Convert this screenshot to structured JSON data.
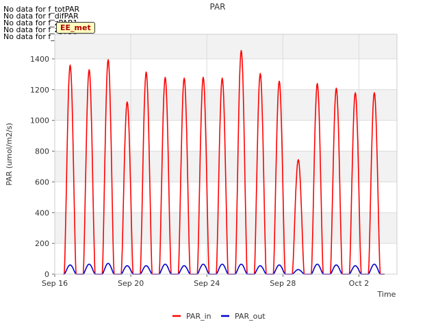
{
  "nodata": [
    "No data for f_totPAR",
    "No data for f_difPAR",
    "No data for f_zPAR1",
    "No data for f_zPAR2",
    "No data for f_zPAR3"
  ],
  "badge": "EE_met",
  "chart_data": {
    "type": "line",
    "title": "PAR",
    "xlabel": "Time",
    "ylabel": "PAR (umol/m2/s)",
    "ylim": [
      0,
      1560
    ],
    "yticks": [
      0,
      200,
      400,
      600,
      800,
      1000,
      1200,
      1400
    ],
    "xlim_days": [
      0,
      18
    ],
    "xticks": [
      {
        "day": 0,
        "label": "Sep 16"
      },
      {
        "day": 4,
        "label": "Sep 20"
      },
      {
        "day": 8,
        "label": "Sep 24"
      },
      {
        "day": 12,
        "label": "Sep 28"
      },
      {
        "day": 16,
        "label": "Oct 2"
      }
    ],
    "grid": true,
    "legend_position": "bottom",
    "series": [
      {
        "name": "PAR_in",
        "color": "#ff0000",
        "daily_peaks": [
          {
            "day": "Sep 16",
            "peak": 1360
          },
          {
            "day": "Sep 17",
            "peak": 1330
          },
          {
            "day": "Sep 18",
            "peak": 1395
          },
          {
            "day": "Sep 19",
            "peak": 1120
          },
          {
            "day": "Sep 20",
            "peak": 1315
          },
          {
            "day": "Sep 21",
            "peak": 1280
          },
          {
            "day": "Sep 22",
            "peak": 1275
          },
          {
            "day": "Sep 23",
            "peak": 1280
          },
          {
            "day": "Sep 24",
            "peak": 1275
          },
          {
            "day": "Sep 25",
            "peak": 1455
          },
          {
            "day": "Sep 26",
            "peak": 1305
          },
          {
            "day": "Sep 27",
            "peak": 1255
          },
          {
            "day": "Sep 28",
            "peak": 745
          },
          {
            "day": "Sep 29",
            "peak": 1240
          },
          {
            "day": "Sep 30",
            "peak": 1210
          },
          {
            "day": "Oct 1",
            "peak": 1180
          },
          {
            "day": "Oct 2",
            "peak": 1180
          }
        ]
      },
      {
        "name": "PAR_out",
        "color": "#0000cc",
        "daily_peaks": [
          {
            "day": "Sep 16",
            "peak": 60
          },
          {
            "day": "Sep 17",
            "peak": 65
          },
          {
            "day": "Sep 18",
            "peak": 70
          },
          {
            "day": "Sep 19",
            "peak": 55
          },
          {
            "day": "Sep 20",
            "peak": 55
          },
          {
            "day": "Sep 21",
            "peak": 65
          },
          {
            "day": "Sep 22",
            "peak": 55
          },
          {
            "day": "Sep 23",
            "peak": 65
          },
          {
            "day": "Sep 24",
            "peak": 65
          },
          {
            "day": "Sep 25",
            "peak": 65
          },
          {
            "day": "Sep 26",
            "peak": 55
          },
          {
            "day": "Sep 27",
            "peak": 60
          },
          {
            "day": "Sep 28",
            "peak": 30
          },
          {
            "day": "Sep 29",
            "peak": 65
          },
          {
            "day": "Sep 30",
            "peak": 60
          },
          {
            "day": "Oct 1",
            "peak": 55
          },
          {
            "day": "Oct 2",
            "peak": 65
          }
        ]
      }
    ]
  }
}
